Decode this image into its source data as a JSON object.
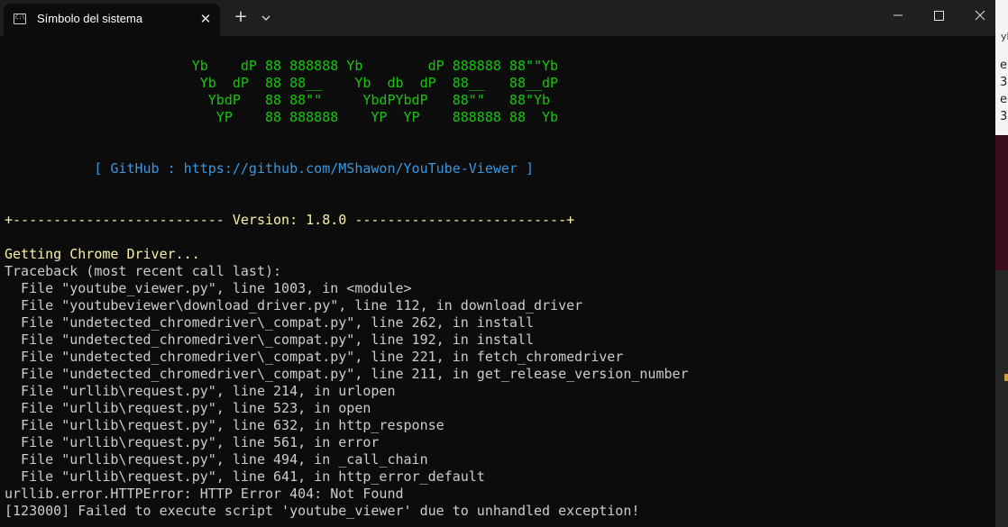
{
  "window": {
    "tab_title": "Símbolo del sistema",
    "tab_icon_text": "C:\\",
    "close_tab": "✕",
    "new_tab": "+",
    "minimize": "—",
    "maximize": "☐",
    "close": "✕"
  },
  "terminal": {
    "banner": [
      "                       Yb    dP 88 888888 Yb        dP 888888 88\"\"Yb",
      "                        Yb  dP  88 88__    Yb  db  dP  88__   88__dP",
      "                         YbdP   88 88\"\"     YbdPYbdP   88\"\"   88\"Yb",
      "                          YP    88 888888    YP  YP    888888 88  Yb"
    ],
    "github_line": "           [ GitHub : https://github.com/MShawon/YouTube-Viewer ]",
    "version_line": "+-------------------------- Version: 1.8.0 --------------------------+",
    "getting_driver": "Getting Chrome Driver...",
    "traceback": [
      "Traceback (most recent call last):",
      "  File \"youtube_viewer.py\", line 1003, in <module>",
      "  File \"youtubeviewer\\download_driver.py\", line 112, in download_driver",
      "  File \"undetected_chromedriver\\_compat.py\", line 262, in install",
      "  File \"undetected_chromedriver\\_compat.py\", line 192, in install",
      "  File \"undetected_chromedriver\\_compat.py\", line 221, in fetch_chromedriver",
      "  File \"undetected_chromedriver\\_compat.py\", line 211, in get_release_version_number",
      "  File \"urllib\\request.py\", line 214, in urlopen",
      "  File \"urllib\\request.py\", line 523, in open",
      "  File \"urllib\\request.py\", line 632, in http_response",
      "  File \"urllib\\request.py\", line 561, in error",
      "  File \"urllib\\request.py\", line 494, in _call_chain",
      "  File \"urllib\\request.py\", line 641, in http_error_default",
      "urllib.error.HTTPError: HTTP Error 404: Not Found",
      "[123000] Failed to execute script 'youtube_viewer' due to unhandled exception!"
    ]
  },
  "background_window": {
    "text_lines": [
      "yb",
      "e",
      "3",
      "e",
      "3"
    ]
  },
  "colors": {
    "banner": "#16c60c",
    "github": "#3a96dd",
    "version": "#f9f1a5",
    "text": "#cccccc",
    "background": "#0c0c0c"
  }
}
